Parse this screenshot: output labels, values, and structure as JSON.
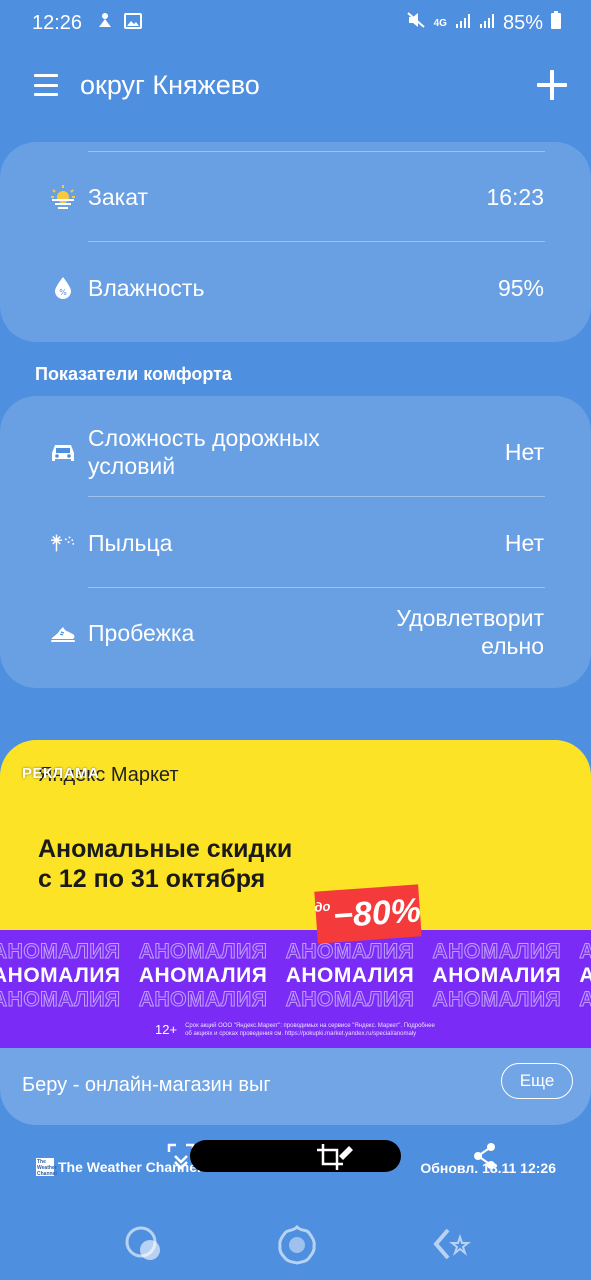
{
  "status_bar": {
    "time": "12:26",
    "network": "4G",
    "battery": "85%"
  },
  "app_bar": {
    "title": "округ Княжево"
  },
  "details": [
    {
      "icon": "sunset-icon",
      "label": "Закат",
      "value": "16:23"
    },
    {
      "icon": "humidity-icon",
      "label": "Влажность",
      "value": "95%"
    }
  ],
  "comfort": {
    "title": "Показатели комфорта",
    "items": [
      {
        "icon": "car-icon",
        "label_line1": "Сложность дорожных",
        "label_line2": "условий",
        "value": "Нет"
      },
      {
        "icon": "pollen-icon",
        "label": "Пыльца",
        "value": "Нет"
      },
      {
        "icon": "running-shoe-icon",
        "label": "Пробежка",
        "value_line1": "Удовлетворит",
        "value_line2": "ельно"
      }
    ]
  },
  "ad": {
    "tag": "РЕКЛАМА",
    "brand": "Яндекс Маркет",
    "headline_line1": "Аномальные скидки",
    "headline_line2": "с 12 по 31 октября",
    "badge_prefix": "до",
    "badge_value": "−80%",
    "banner_word": "АНОМАЛИЯ",
    "age_rating": "12+",
    "legal_text": "Срок акций ООО \"Яндекс.Маркет\": проводимых на сервисе \"Яндекс. Маркет\". Подробнее об акциях и сроках проведения см. https://pokupki.market.yandex.ru/special/anomaly",
    "source": "Беру - онлайн-магазин выг",
    "more_button": "Еще"
  },
  "footer": {
    "provider": "The Weather Channel",
    "updated": "Обновл. 18.11 12:26"
  },
  "colors": {
    "background": "#4f8fdf",
    "ad_yellow": "#fde326",
    "ad_purple": "#7a2cf6",
    "badge_red": "#f43a3a"
  }
}
